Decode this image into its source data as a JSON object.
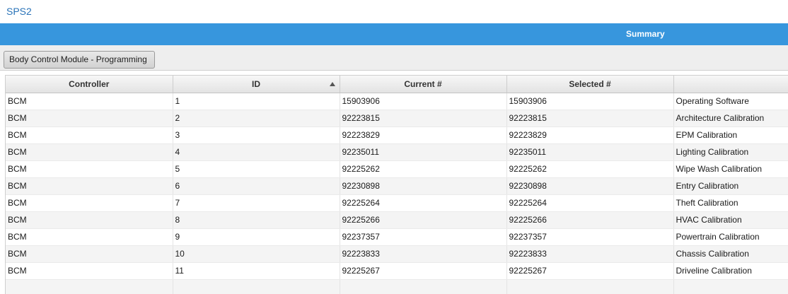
{
  "app": {
    "title": "SPS2"
  },
  "banner": {
    "title": "Summary"
  },
  "toolbar": {
    "module_button": "Body Control Module - Programming"
  },
  "table": {
    "columns": [
      "Controller",
      "ID",
      "Current #",
      "Selected #",
      ""
    ],
    "sorted_column": "ID",
    "rows": [
      [
        "BCM",
        "1",
        "15903906",
        "15903906",
        "Operating Software"
      ],
      [
        "BCM",
        "2",
        "92223815",
        "92223815",
        "Architecture Calibration"
      ],
      [
        "BCM",
        "3",
        "92223829",
        "92223829",
        "EPM Calibration"
      ],
      [
        "BCM",
        "4",
        "92235011",
        "92235011",
        "Lighting Calibration"
      ],
      [
        "BCM",
        "5",
        "92225262",
        "92225262",
        "Wipe Wash Calibration"
      ],
      [
        "BCM",
        "6",
        "92230898",
        "92230898",
        "Entry Calibration"
      ],
      [
        "BCM",
        "7",
        "92225264",
        "92225264",
        "Theft Calibration"
      ],
      [
        "BCM",
        "8",
        "92225266",
        "92225266",
        "HVAC Calibration"
      ],
      [
        "BCM",
        "9",
        "92237357",
        "92237357",
        "Powertrain Calibration"
      ],
      [
        "BCM",
        "10",
        "92223833",
        "92223833",
        "Chassis Calibration"
      ],
      [
        "BCM",
        "11",
        "92225267",
        "92225267",
        "Driveline Calibration"
      ]
    ]
  },
  "colors": {
    "banner": "#3796dd",
    "title_text": "#2a73b8"
  },
  "icons": {
    "sort": "sort-ascending-icon"
  }
}
